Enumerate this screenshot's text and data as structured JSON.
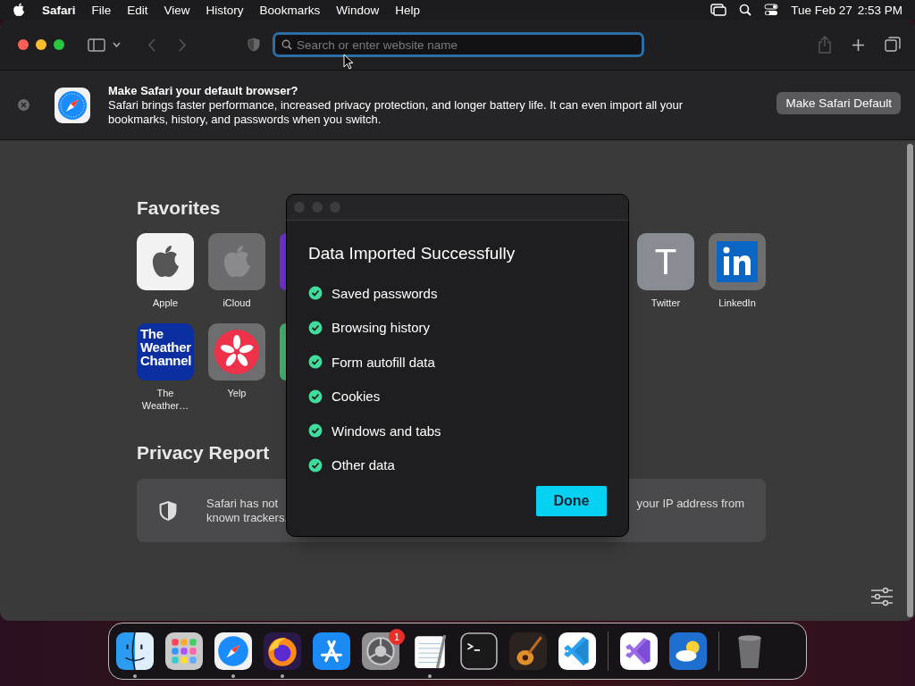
{
  "menu_bar": {
    "app": "Safari",
    "items": [
      "File",
      "Edit",
      "View",
      "History",
      "Bookmarks",
      "Window",
      "Help"
    ],
    "date": "Tue Feb 27",
    "time": "2:53 PM"
  },
  "toolbar": {
    "search": {
      "placeholder": "Search or enter website name"
    }
  },
  "banner": {
    "title": "Make Safari your default browser?",
    "text": "Safari brings faster performance, increased privacy protection, and longer battery life. It can even import all your bookmarks, history, and passwords when you switch.",
    "button": "Make Safari Default"
  },
  "favorites": {
    "title": "Favorites",
    "rows": [
      {
        "left": [
          {
            "label": "Apple",
            "kind": "apple"
          },
          {
            "label": "iCloud",
            "kind": "icloud"
          },
          {
            "kind": "partial",
            "color": "#6b2fd0"
          }
        ],
        "right": [
          {
            "label": "Twitter",
            "kind": "letter",
            "letter": "T"
          },
          {
            "label": "LinkedIn",
            "kind": "linkedin"
          }
        ]
      },
      {
        "left": [
          {
            "label": "The Weather…",
            "kind": "weather",
            "logo": [
              "The",
              "Weather",
              "Channel"
            ]
          },
          {
            "label": "Yelp",
            "kind": "yelp"
          },
          {
            "kind": "partial",
            "color": "#3fae6a"
          }
        ],
        "right": []
      }
    ]
  },
  "privacy_report": {
    "title": "Privacy Report",
    "text_left": "Safari has not",
    "text_left_2": "known trackers.",
    "text_right": "your IP address from"
  },
  "dialog": {
    "title": "Data Imported Successfully",
    "items": [
      {
        "label": "Saved passwords",
        "done": true
      },
      {
        "label": "Browsing history",
        "done": true
      },
      {
        "label": "Form autofill data",
        "done": true
      },
      {
        "label": "Cookies",
        "done": true
      },
      {
        "label": "Windows and tabs",
        "done": true
      },
      {
        "label": "Other data",
        "done": true
      }
    ],
    "button": "Done"
  },
  "dock": {
    "apps": [
      {
        "kind": "finder",
        "running": true
      },
      {
        "kind": "launchpad",
        "running": false
      },
      {
        "kind": "safari",
        "running": true
      },
      {
        "kind": "firefox",
        "running": true
      },
      {
        "kind": "appstore",
        "running": false
      },
      {
        "kind": "settings",
        "running": false,
        "badge": "1"
      },
      {
        "kind": "textedit",
        "running": true
      },
      {
        "kind": "terminal",
        "running": false
      },
      {
        "kind": "garageband",
        "running": false
      },
      {
        "kind": "vscode",
        "running": false
      },
      {
        "kind": "divider"
      },
      {
        "kind": "visualstudio",
        "running": false
      },
      {
        "kind": "weather",
        "running": false
      },
      {
        "kind": "divider"
      },
      {
        "kind": "trash",
        "running": false
      }
    ]
  }
}
